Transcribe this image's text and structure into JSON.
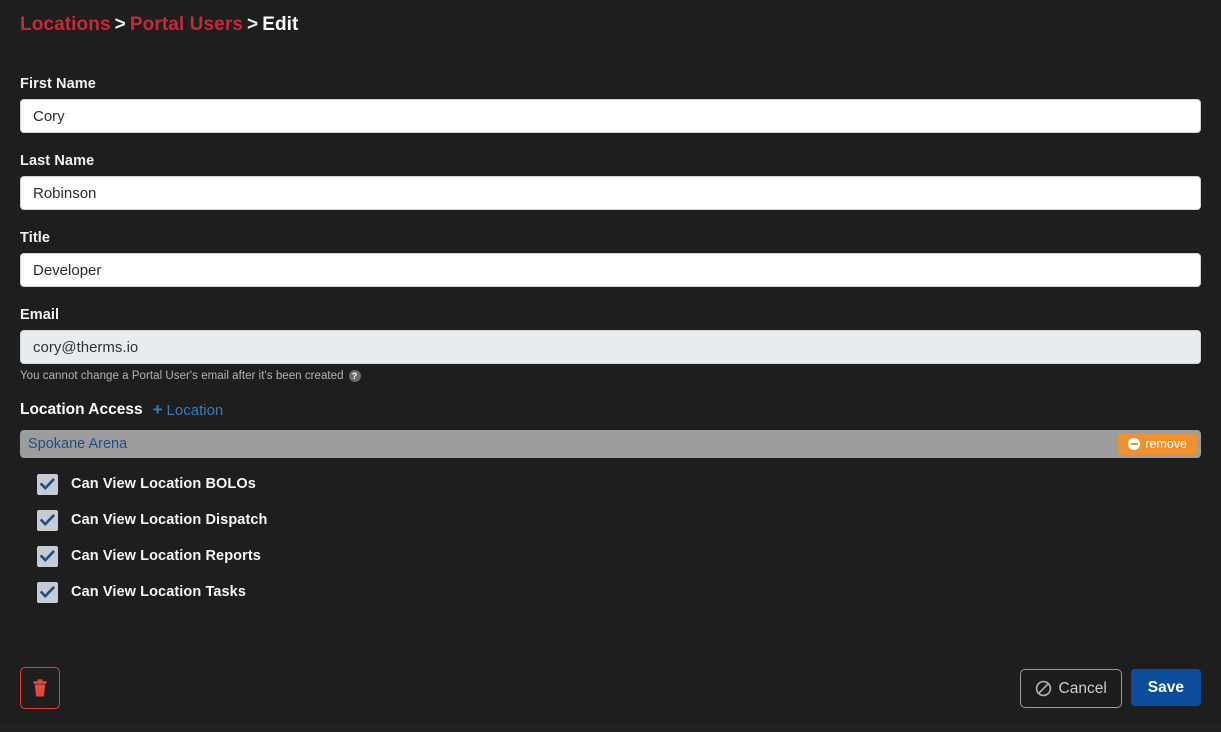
{
  "breadcrumb": {
    "items": [
      {
        "label": "Locations",
        "current": false
      },
      {
        "label": "Portal Users",
        "current": false
      },
      {
        "label": "Edit",
        "current": true
      }
    ],
    "separator": ">"
  },
  "form": {
    "first_name": {
      "label": "First Name",
      "value": "Cory",
      "placeholder": "First Name"
    },
    "last_name": {
      "label": "Last Name",
      "value": "Robinson",
      "placeholder": "Last Name"
    },
    "title": {
      "label": "Title",
      "value": "Developer",
      "placeholder": "Title"
    },
    "email": {
      "label": "Email",
      "value": "cory@therms.io",
      "placeholder": "Email",
      "help_text": "You cannot change a Portal User's email after it's been created",
      "help_icon": "question-circle-icon",
      "help_glyph": "?"
    }
  },
  "location_access": {
    "title": "Location Access",
    "add_label": "Location",
    "add_icon": "plus-icon",
    "add_glyph": "+",
    "locations": [
      {
        "name": "Spokane Arena",
        "remove_label": "remove",
        "remove_icon": "minus-circle-icon",
        "permissions": [
          {
            "label": "Can View Location BOLOs",
            "checked": true
          },
          {
            "label": "Can View Location Dispatch",
            "checked": true
          },
          {
            "label": "Can View Location Reports",
            "checked": true
          },
          {
            "label": "Can View Location Tasks",
            "checked": true
          }
        ]
      }
    ]
  },
  "actions": {
    "delete": {
      "label": "",
      "icon": "trash-icon"
    },
    "cancel": {
      "label": "Cancel",
      "icon": "ban-icon"
    },
    "save": {
      "label": "Save"
    }
  },
  "colors": {
    "background": "#1e1e1e",
    "breadcrumb_link": "#c22a38",
    "link_blue": "#2980c4",
    "location_row": "#9c9c9c",
    "location_name": "#1f4f8b",
    "remove_orange": "#f0902f",
    "save_blue": "#0d4d9b",
    "delete_red": "#e43b32",
    "checkbox_fill": "#c6cbd4",
    "checkmark": "#1b4f86"
  }
}
